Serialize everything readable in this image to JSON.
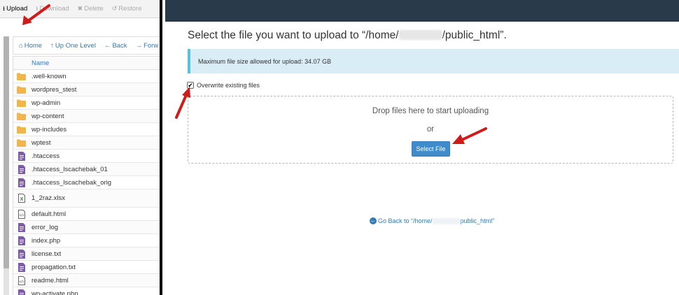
{
  "toolbar": {
    "items": [
      {
        "label": "Upload",
        "icon": "upload-icon",
        "active": true
      },
      {
        "label": "Download",
        "icon": "download-icon",
        "active": false
      },
      {
        "label": "Delete",
        "icon": "delete-icon",
        "active": false
      },
      {
        "label": "Restore",
        "icon": "restore-icon",
        "active": false
      }
    ]
  },
  "nav": {
    "home": "Home",
    "up": "Up One Level",
    "back": "Back",
    "forward": "Forw"
  },
  "filelist": {
    "header": "Name",
    "items": [
      {
        "name": ".well-known",
        "type": "folder"
      },
      {
        "name": "wordpres_stest",
        "type": "folder"
      },
      {
        "name": "wp-admin",
        "type": "folder"
      },
      {
        "name": "wp-content",
        "type": "folder"
      },
      {
        "name": "wp-includes",
        "type": "folder"
      },
      {
        "name": "wptest",
        "type": "folder"
      },
      {
        "name": ".htaccess",
        "type": "file"
      },
      {
        "name": ".htaccess_lscachebak_01",
        "type": "file"
      },
      {
        "name": ".htaccess_lscachebak_orig",
        "type": "file"
      },
      {
        "name": "1_2raz.xlsx",
        "type": "excel"
      },
      {
        "name": "default.html",
        "type": "code"
      },
      {
        "name": "error_log",
        "type": "file"
      },
      {
        "name": "index.php",
        "type": "file"
      },
      {
        "name": "license.txt",
        "type": "file"
      },
      {
        "name": "propagation.txt",
        "type": "file"
      },
      {
        "name": "readme.html",
        "type": "code"
      },
      {
        "name": "wp-activate.php",
        "type": "file"
      }
    ]
  },
  "upload": {
    "heading_prefix": "Select the file you want to upload to “/home/",
    "heading_suffix": "/public_html”.",
    "max_size": "Maximum file size allowed for upload: 34.07 GB",
    "overwrite_label": "Overwrite existing files",
    "overwrite_checked": true,
    "drop_text": "Drop files here to start uploading",
    "or_text": "or",
    "select_button": "Select File",
    "goback_prefix": "Go Back to “/home/",
    "goback_suffix": "public_html”"
  },
  "colors": {
    "topbar": "#293a4a",
    "link": "#337ab7",
    "button": "#428bca",
    "info_bg": "#d9edf7",
    "folder": "#f0b64a",
    "file": "#7e5ba6",
    "excel": "#2e7d32",
    "arrow": "#d11a1a"
  }
}
